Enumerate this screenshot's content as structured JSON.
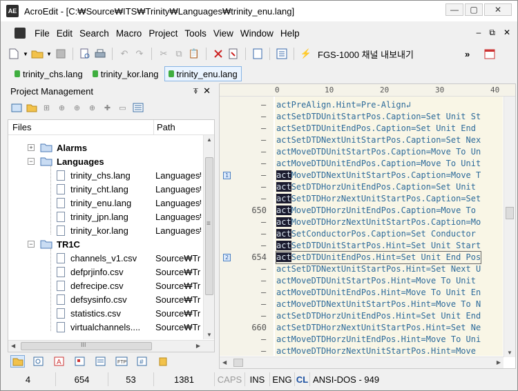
{
  "window": {
    "title": "AcroEdit - [C:₩Source₩ITS₩Trinity₩Languages₩trinity_enu.lang]",
    "app_icon_text": "AE",
    "minimize": "—",
    "maximize": "▢",
    "close": "✕"
  },
  "menu": {
    "items": [
      "File",
      "Edit",
      "Search",
      "Macro",
      "Project",
      "Tools",
      "View",
      "Window",
      "Help"
    ],
    "mdi_min": "–",
    "mdi_restore": "⧉",
    "mdi_close": "✕"
  },
  "toolbar": {
    "label": "FGS-1000 채널 내보내기",
    "overflow": "»"
  },
  "doc_tabs": [
    {
      "label": "trinity_chs.lang",
      "active": false
    },
    {
      "label": "trinity_kor.lang",
      "active": false
    },
    {
      "label": "trinity_enu.lang",
      "active": true
    }
  ],
  "project_panel": {
    "title": "Project Management",
    "pin": "⍕",
    "close": "✕",
    "col_files": "Files",
    "col_path": "Path",
    "tree": [
      {
        "name": "Alarms",
        "path": "",
        "type": "folder",
        "bold": true,
        "expander": "+"
      },
      {
        "name": "Languages",
        "path": "",
        "type": "folder",
        "bold": true,
        "expander": "−"
      },
      {
        "name": "trinity_chs.lang",
        "path": "Languages₩",
        "type": "file"
      },
      {
        "name": "trinity_cht.lang",
        "path": "Languages₩",
        "type": "file"
      },
      {
        "name": "trinity_enu.lang",
        "path": "Languages₩",
        "type": "file"
      },
      {
        "name": "trinity_jpn.lang",
        "path": "Languages₩",
        "type": "file"
      },
      {
        "name": "trinity_kor.lang",
        "path": "Languages₩",
        "type": "file"
      },
      {
        "name": "TR1C",
        "path": "",
        "type": "folder",
        "bold": true,
        "expander": "−"
      },
      {
        "name": "channels_v1.csv",
        "path": "Source₩Tri",
        "type": "file"
      },
      {
        "name": "defprjinfo.csv",
        "path": "Source₩Tri",
        "type": "file"
      },
      {
        "name": "defrecipe.csv",
        "path": "Source₩Tri",
        "type": "file"
      },
      {
        "name": "defsysinfo.csv",
        "path": "Source₩Tri",
        "type": "file"
      },
      {
        "name": "statistics.csv",
        "path": "Source₩Tri",
        "type": "file"
      },
      {
        "name": "virtualchannels....",
        "path": "Source₩Tri",
        "type": "file"
      }
    ],
    "hscroll_grip": "III",
    "vscroll_grip": "≡"
  },
  "editor": {
    "ruler": [
      "0",
      "10",
      "20",
      "30",
      "40"
    ],
    "lines": [
      {
        "gutter": "–",
        "num": "",
        "text": "actPreAlign.Hint=Pre-Align↲",
        "bm": ""
      },
      {
        "gutter": "–",
        "num": "",
        "text": "actSetDTDUnitStartPos.Caption=Set Unit St",
        "bm": ""
      },
      {
        "gutter": "–",
        "num": "",
        "text": "actSetDTDUnitEndPos.Caption=Set Unit End",
        "bm": ""
      },
      {
        "gutter": "–",
        "num": "",
        "text": "actSetDTDNextUnitStartPos.Caption=Set Nex",
        "bm": ""
      },
      {
        "gutter": "–",
        "num": "",
        "text": "actMoveDTDUnitStartPos.Caption=Move To Un",
        "bm": ""
      },
      {
        "gutter": "–",
        "num": "",
        "text": "actMoveDTDUnitEndPos.Caption=Move To Unit",
        "bm": ""
      },
      {
        "gutter": "–",
        "num": "",
        "text": "actMoveDTDNextUnitStartPos.Caption=Move T",
        "bm": "1"
      },
      {
        "gutter": "–",
        "num": "",
        "text": "actSetDTDHorzUnitEndPos.Caption=Set Unit",
        "bm": ""
      },
      {
        "gutter": "–",
        "num": "",
        "text": "actSetDTDHorzNextUnitStartPos.Caption=Set",
        "bm": ""
      },
      {
        "gutter": "",
        "num": "650",
        "text": "actMoveDTDHorzUnitEndPos.Caption=Move To",
        "bm": ""
      },
      {
        "gutter": "–",
        "num": "",
        "text": "actMoveDTDHorzNextUnitStartPos.Caption=Mo",
        "bm": ""
      },
      {
        "gutter": "–",
        "num": "",
        "text": "actSetConductorPos.Caption=Set Conductor",
        "bm": ""
      },
      {
        "gutter": "–",
        "num": "",
        "text": "actSetDTDUnitStartPos.Hint=Set Unit Start",
        "bm": ""
      },
      {
        "gutter": "",
        "num": "654",
        "text": "actSetDTDUnitEndPos.Hint=Set Unit End Pos",
        "bm": "2"
      },
      {
        "gutter": "–",
        "num": "",
        "text": "actSetDTDNextUnitStartPos.Hint=Set Next U",
        "bm": ""
      },
      {
        "gutter": "–",
        "num": "",
        "text": "actMoveDTDUnitStartPos.Hint=Move To Unit",
        "bm": ""
      },
      {
        "gutter": "–",
        "num": "",
        "text": "actMoveDTDUnitEndPos.Hint=Move To Unit En",
        "bm": ""
      },
      {
        "gutter": "–",
        "num": "",
        "text": "actMoveDTDNextUnitStartPos.Hint=Move To N",
        "bm": ""
      },
      {
        "gutter": "–",
        "num": "",
        "text": "actSetDTDHorzUnitEndPos.Hint=Set Unit End",
        "bm": ""
      },
      {
        "gutter": "",
        "num": "660",
        "text": "actSetDTDHorzNextUnitStartPos.Hint=Set Ne",
        "bm": ""
      },
      {
        "gutter": "–",
        "num": "",
        "text": "actMoveDTDHorzUnitEndPos.Hint=Move To Uni",
        "bm": ""
      },
      {
        "gutter": "–",
        "num": "",
        "text": "actMoveDTDHorzNextUnitStartPos.Hint=Move",
        "bm": ""
      }
    ]
  },
  "status": {
    "col": "4",
    "line": "654",
    "c3": "53",
    "c4": "1381",
    "caps": "CAPS",
    "ins": "INS",
    "lang": "ENG",
    "cl": "CL",
    "encoding": "ANSI-DOS - 949"
  }
}
